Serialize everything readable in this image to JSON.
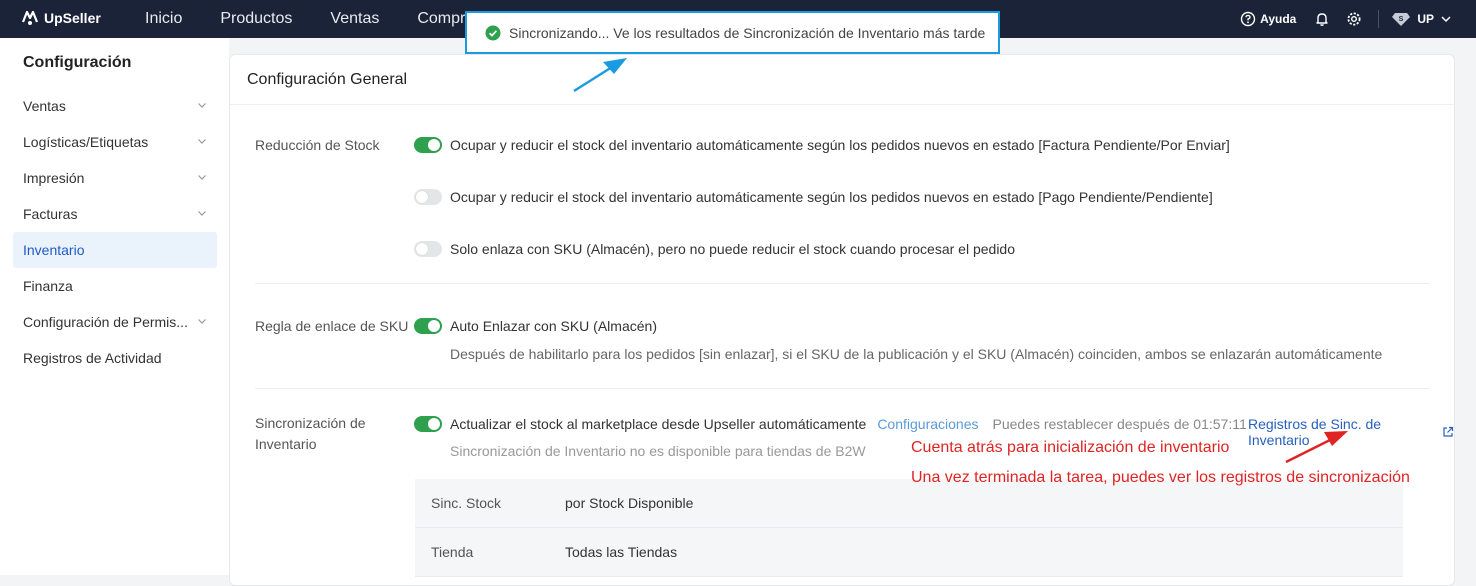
{
  "app": {
    "brand": "UpSeller"
  },
  "nav": [
    "Inicio",
    "Productos",
    "Ventas",
    "Compras"
  ],
  "topbar": {
    "help": "Ayuda",
    "user": "UP"
  },
  "sidebar": {
    "title": "Configuración",
    "items": [
      {
        "label": "Ventas",
        "expandable": true
      },
      {
        "label": "Logísticas/Etiquetas",
        "expandable": true
      },
      {
        "label": "Impresión",
        "expandable": true
      },
      {
        "label": "Facturas",
        "expandable": true
      },
      {
        "label": "Inventario",
        "active": true
      },
      {
        "label": "Finanza"
      },
      {
        "label": "Configuración de Permis...",
        "expandable": true
      },
      {
        "label": "Registros de Actividad"
      }
    ]
  },
  "main": {
    "title": "Configuración General",
    "stock_reduction": {
      "label": "Reducción de Stock",
      "options": [
        {
          "text": "Ocupar y reducir el stock del inventario automáticamente según los pedidos nuevos en estado [Factura Pendiente/Por Enviar]",
          "on": true
        },
        {
          "text": "Ocupar y reducir el stock del inventario automáticamente según los pedidos nuevos en estado [Pago Pendiente/Pendiente]",
          "on": false
        },
        {
          "text": "Solo enlaza con SKU (Almacén), pero no puede reducir el stock cuando procesar el pedido",
          "on": false
        }
      ]
    },
    "sku_link": {
      "label": "Regla de enlace de SKU",
      "option": "Auto Enlazar con SKU (Almacén)",
      "hint": "Después de habilitarlo para los pedidos [sin enlazar], si el SKU de la publicación y el SKU (Almacén) coinciden, ambos se enlazarán automáticamente"
    },
    "sync": {
      "label_line1": "Sincronización de",
      "label_line2": "Inventario",
      "option": "Actualizar el stock al marketplace desde Upseller automáticamente",
      "config_link": "Configuraciones",
      "countdown": "Puedes restablecer después de 01:57:11",
      "logs_link": "Registros de Sinc. de Inventario",
      "hint": "Sincronización de Inventario no es disponible para tiendas de B2W",
      "table": [
        {
          "key": "Sinc. Stock",
          "value": "por Stock Disponible"
        },
        {
          "key": "Tienda",
          "value": "Todas las Tiendas"
        }
      ]
    }
  },
  "toast": {
    "text": "Sincronizando... Ve los resultados de Sincronización de Inventario más tarde"
  },
  "annotations": {
    "note1": "Cuenta atrás para inicialización de inventario",
    "note2": "Una vez terminada la tarea, puedes ver los registros de sincronización"
  },
  "colors": {
    "topbar": "#1b2338",
    "accent": "#2ea04e",
    "link": "#2760be",
    "annotation": "#e02424",
    "toast_border": "#1a9be0"
  }
}
